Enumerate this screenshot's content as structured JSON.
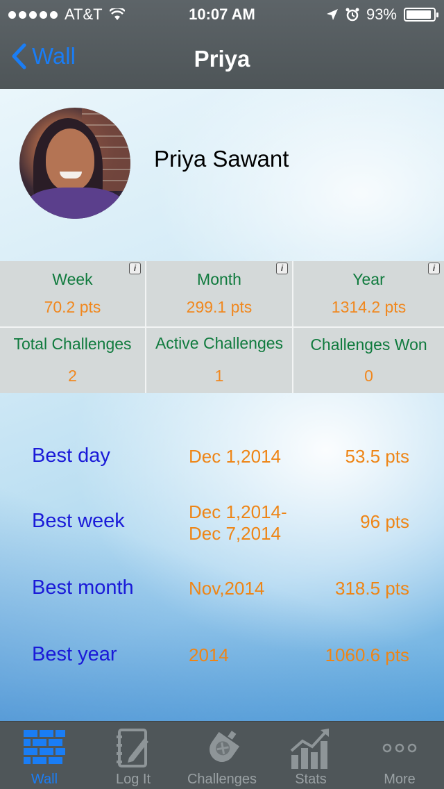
{
  "status": {
    "carrier": "AT&T",
    "time": "10:07 AM",
    "battery": "93%",
    "battery_level": 0.93
  },
  "nav": {
    "back_label": "Wall",
    "title": "Priya"
  },
  "profile": {
    "name": "Priya Sawant"
  },
  "stats": {
    "week": {
      "label": "Week",
      "value": "70.2 pts"
    },
    "month": {
      "label": "Month",
      "value": "299.1 pts"
    },
    "year": {
      "label": "Year",
      "value": "1314.2 pts"
    },
    "total": {
      "label": "Total Challenges",
      "value": "2"
    },
    "active": {
      "label": "Active Challenges",
      "value": "1"
    },
    "won": {
      "label": "Challenges Won",
      "value": "0"
    }
  },
  "best": [
    {
      "label": "Best day",
      "date": "Dec 1,2014",
      "points": "53.5 pts"
    },
    {
      "label": "Best week",
      "date_line1": "Dec 1,2014-",
      "date_line2": "Dec 7,2014",
      "points": "96 pts"
    },
    {
      "label": "Best month",
      "date": "Nov,2014",
      "points": "318.5 pts"
    },
    {
      "label": "Best year",
      "date": "2014",
      "points": "1060.6 pts"
    }
  ],
  "tabs": [
    {
      "label": "Wall",
      "icon": "wall-icon",
      "active": true
    },
    {
      "label": "Log It",
      "icon": "log-it-icon"
    },
    {
      "label": "Challenges",
      "icon": "challenges-icon"
    },
    {
      "label": "Stats",
      "icon": "stats-icon"
    },
    {
      "label": "More",
      "icon": "more-icon"
    }
  ],
  "colors": {
    "accent": "#1a7df5",
    "label_green": "#0f7a3d",
    "value_orange": "#f0881f",
    "best_blue": "#1a1ad8",
    "bar": "#4f5659"
  }
}
